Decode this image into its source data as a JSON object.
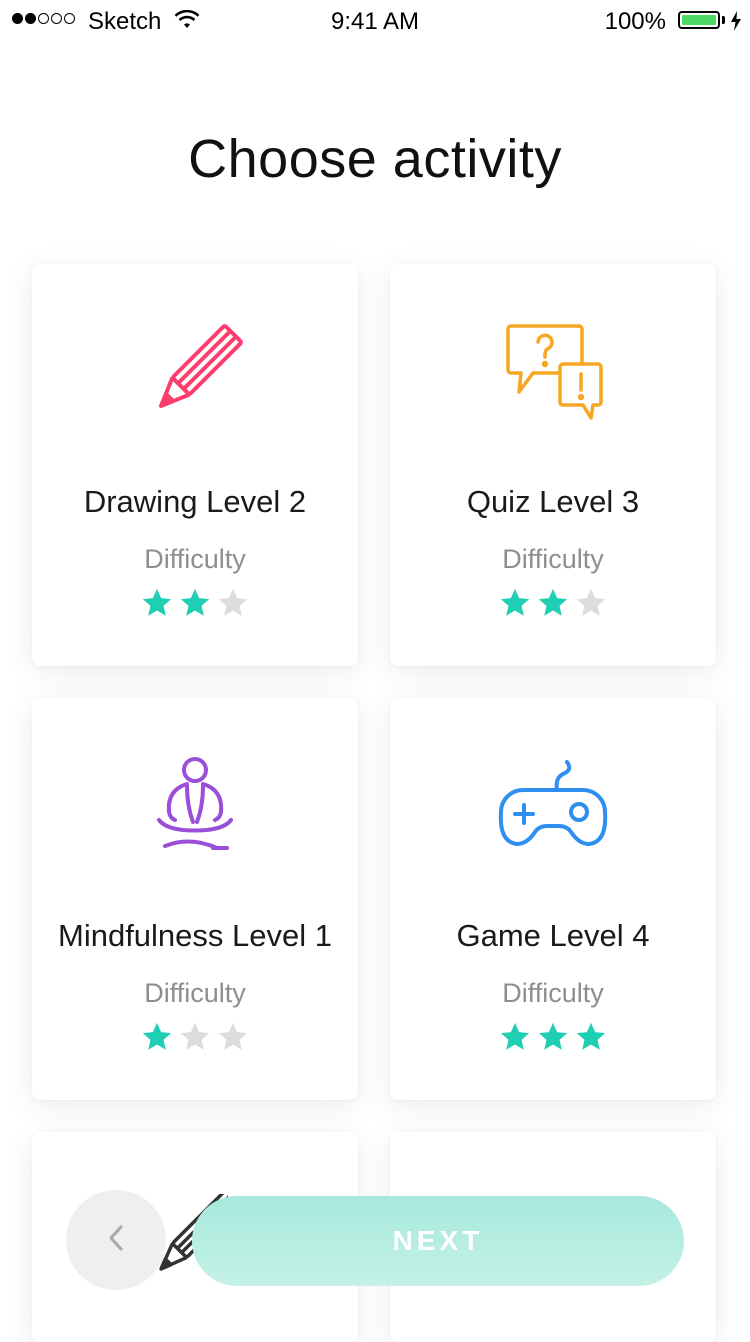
{
  "status_bar": {
    "carrier": "Sketch",
    "time": "9:41 AM",
    "battery": "100%",
    "signal_bars_filled": 2,
    "signal_bars_total": 5
  },
  "page": {
    "title": "Choose activity"
  },
  "cards": [
    {
      "title": "Drawing Level 2",
      "difficulty_label": "Difficulty",
      "stars_filled": 2,
      "stars_total": 3,
      "icon": "pencil-icon",
      "icon_color": "#ff3c6e"
    },
    {
      "title": "Quiz Level 3",
      "difficulty_label": "Difficulty",
      "stars_filled": 2,
      "stars_total": 3,
      "icon": "quiz-bubbles-icon",
      "icon_color": "#f6a623"
    },
    {
      "title": "Mindfulness Level 1",
      "difficulty_label": "Difficulty",
      "stars_filled": 1,
      "stars_total": 3,
      "icon": "meditation-icon",
      "icon_color": "#9b4fd9"
    },
    {
      "title": "Game Level 4",
      "difficulty_label": "Difficulty",
      "stars_filled": 3,
      "stars_total": 3,
      "icon": "gamepad-icon",
      "icon_color": "#2f8ff0"
    }
  ],
  "colors": {
    "star_filled": "#1fcfb4",
    "star_empty": "#dcdcdc",
    "next_button": "#b4eee2"
  },
  "footer": {
    "back_icon": "chevron-left-icon",
    "next_label": "NEXT"
  }
}
